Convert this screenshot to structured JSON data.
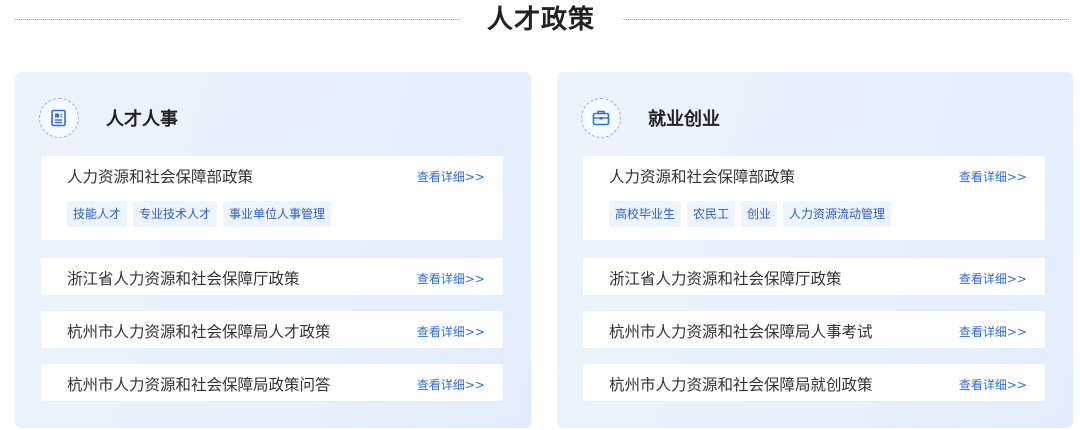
{
  "section_title": "人才政策",
  "panels": [
    {
      "title": "人才人事",
      "icon": "document-icon",
      "items": [
        {
          "name": "人力资源和社会保障部政策",
          "more": "查看详细>>",
          "tags": [
            "技能人才",
            "专业技术人才",
            "事业单位人事管理"
          ]
        },
        {
          "name": "浙江省人力资源和社会保障厅政策",
          "more": "查看详细>>"
        },
        {
          "name": "杭州市人力资源和社会保障局人才政策",
          "more": "查看详细>>"
        },
        {
          "name": "杭州市人力资源和社会保障局政策问答",
          "more": "查看详细>>"
        }
      ]
    },
    {
      "title": "就业创业",
      "icon": "briefcase-icon",
      "items": [
        {
          "name": "人力资源和社会保障部政策",
          "more": "查看详细>>",
          "tags": [
            "高校毕业生",
            "农民工",
            "创业",
            "人力资源流动管理"
          ]
        },
        {
          "name": "浙江省人力资源和社会保障厅政策",
          "more": "查看详细>>"
        },
        {
          "name": "杭州市人力资源和社会保障局人事考试",
          "more": "查看详细>>"
        },
        {
          "name": "杭州市人力资源和社会保障局就创政策",
          "more": "查看详细>>"
        }
      ]
    }
  ],
  "colors": {
    "accent": "#2f6de1",
    "tag_bg": "#eef4fd",
    "panel_bg": "#e8f0fd"
  }
}
